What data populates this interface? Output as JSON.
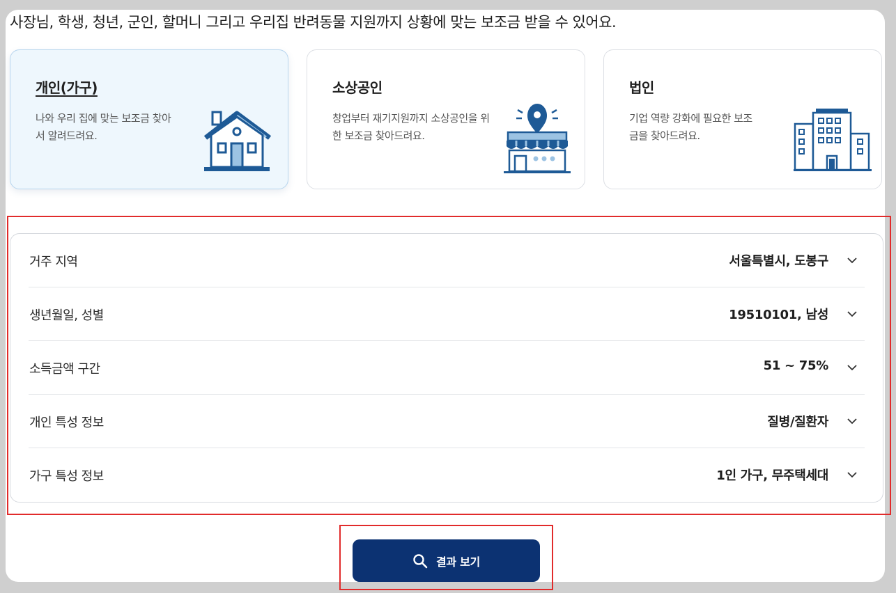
{
  "intro_text": "사장님, 학생, 청년, 군인, 할머니 그리고 우리집 반려동물 지원까지 상황에 맞는 보조금 받을 수 있어요.",
  "cards": [
    {
      "title": "개인(가구)",
      "desc": "나와 우리 집에 맞는 보조금 찾아서 알려드려요.",
      "icon": "house-icon",
      "selected": true
    },
    {
      "title": "소상공인",
      "desc": "창업부터 재기지원까지 소상공인을 위한 보조금 찾아드려요.",
      "icon": "store-location-icon",
      "selected": false
    },
    {
      "title": "법인",
      "desc": "기업 역량 강화에 필요한 보조금을 찾아드려요.",
      "icon": "office-building-icon",
      "selected": false
    }
  ],
  "form": {
    "rows": [
      {
        "label": "거주 지역",
        "value": "서울특별시, 도봉구"
      },
      {
        "label": "생년월일, 성별",
        "value": "19510101, 남성"
      },
      {
        "label": "소득금액 구간",
        "value": "51 ~ 75%"
      },
      {
        "label": "개인 특성 정보",
        "value": "질병/질환자"
      },
      {
        "label": "가구 특성 정보",
        "value": "1인 가구, 무주택세대"
      }
    ]
  },
  "result_button": {
    "label": "결과 보기",
    "icon": "search-icon"
  },
  "colors": {
    "primary": "#0c3272",
    "icon_blue": "#1e5a96",
    "selected_card_bg": "#eef7fd",
    "highlight_red": "#e12b2b"
  }
}
